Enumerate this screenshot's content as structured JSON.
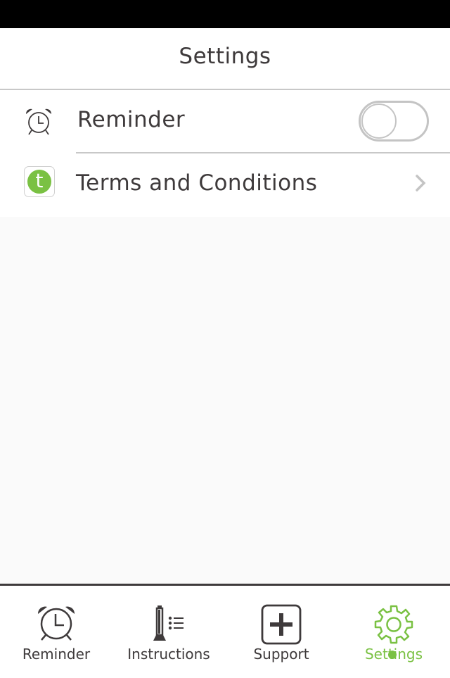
{
  "header": {
    "title": "Settings"
  },
  "settings": {
    "items": [
      {
        "label": "Reminder",
        "icon": "alarm-clock-icon",
        "control": "toggle",
        "toggle_on": false
      },
      {
        "label": "Terms and Conditions",
        "icon": "terms-t-icon",
        "icon_letter": "t",
        "control": "chevron"
      }
    ]
  },
  "tabbar": {
    "tabs": [
      {
        "label": "Reminder",
        "icon": "alarm-clock-icon",
        "active": false
      },
      {
        "label": "Instructions",
        "icon": "instructions-list-icon",
        "active": false
      },
      {
        "label": "Support",
        "icon": "plus-box-icon",
        "active": false
      },
      {
        "label": "Settings",
        "icon": "gear-icon",
        "active": true
      }
    ]
  },
  "colors": {
    "accent": "#7ac143",
    "text": "#3e3a3b",
    "separator": "#c8c8c8"
  }
}
